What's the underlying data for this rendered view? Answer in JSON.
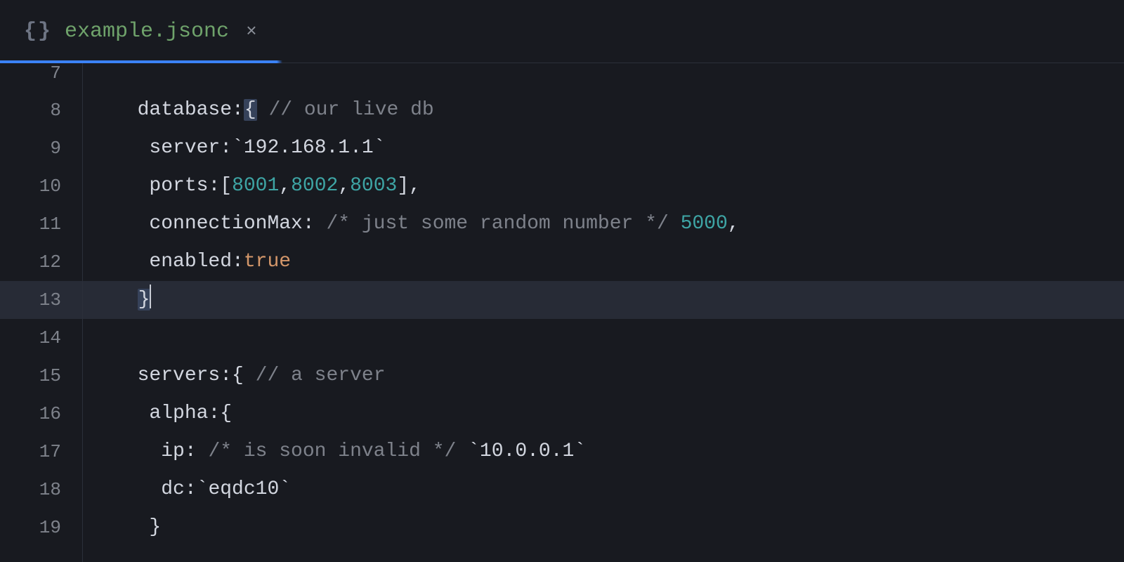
{
  "tab": {
    "icon_name": "braces-icon",
    "icon_glyph": "{}",
    "filename": "example.jsonc",
    "close_glyph": "×"
  },
  "editor": {
    "first_visible_line": 7,
    "active_line": 13,
    "line_numbers": [
      "7",
      "8",
      "9",
      "10",
      "11",
      "12",
      "13",
      "14",
      "15",
      "16",
      "17",
      "18",
      "19"
    ]
  },
  "code": {
    "l8": {
      "indent": "  ",
      "key": "database",
      "brace_open": "{",
      "comment": "// our live db"
    },
    "l9": {
      "indent": "   ",
      "key": "server",
      "tick1": "`",
      "str": "192.168.1.1",
      "tick2": "`"
    },
    "l10": {
      "indent": "   ",
      "key": "ports",
      "lb": "[",
      "n1": "8001",
      "c1": ",",
      "n2": "8002",
      "c2": ",",
      "n3": "8003",
      "rb": "]",
      "trail": ","
    },
    "l11": {
      "indent": "   ",
      "key": "connectionMax",
      "comment": "/* just some random number */",
      "num": "5000",
      "trail": ","
    },
    "l12": {
      "indent": "   ",
      "key": "enabled",
      "bool": "true"
    },
    "l13": {
      "indent": "  ",
      "brace_close": "}"
    },
    "l15": {
      "indent": "  ",
      "key": "servers",
      "brace_open": "{",
      "comment": "// a server"
    },
    "l16": {
      "indent": "   ",
      "key": "alpha",
      "brace_open": "{"
    },
    "l17": {
      "indent": "    ",
      "key": "ip",
      "comment": "/* is soon invalid */",
      "tick1": "`",
      "str": "10.0.0.1",
      "tick2": "`"
    },
    "l18": {
      "indent": "    ",
      "key": "dc",
      "tick1": "`",
      "str": "eqdc10",
      "tick2": "`"
    },
    "l19": {
      "indent": "   ",
      "brace_close": "}"
    }
  }
}
